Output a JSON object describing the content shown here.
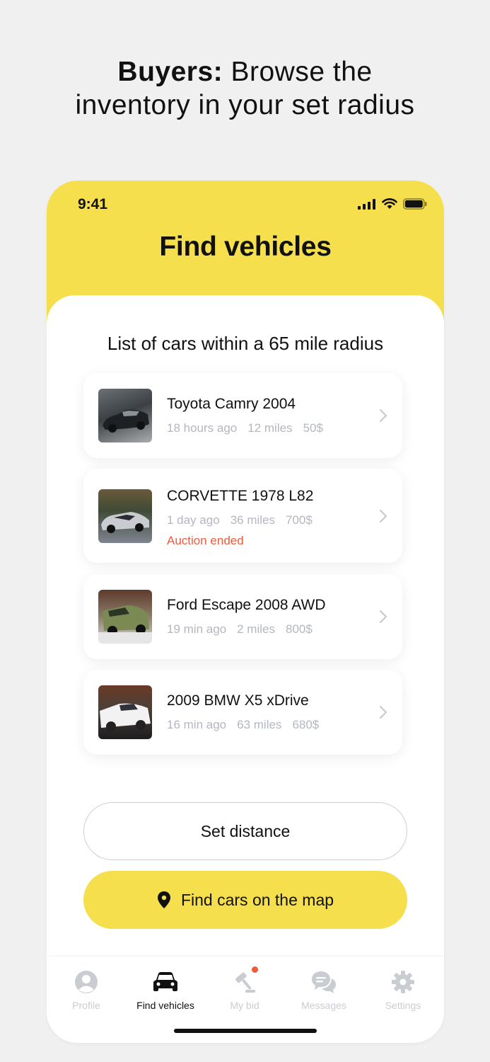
{
  "headline": {
    "bold": "Buyers:",
    "rest": " Browse the",
    "line2": "inventory in your set radius"
  },
  "status_bar": {
    "time": "9:41"
  },
  "screen": {
    "title": "Find vehicles",
    "list_title": "List of cars within a 65 mile radius"
  },
  "cars": [
    {
      "name": "Toyota Camry 2004",
      "time": "18 hours ago",
      "distance": "12 miles",
      "price": "50$",
      "status": ""
    },
    {
      "name": "CORVETTE 1978 L82",
      "time": "1 day ago",
      "distance": "36 miles",
      "price": "700$",
      "status": "Auction ended"
    },
    {
      "name": "Ford Escape 2008 AWD",
      "time": "19 min ago",
      "distance": "2 miles",
      "price": "800$",
      "status": ""
    },
    {
      "name": "2009 BMW X5 xDrive",
      "time": "16 min ago",
      "distance": "63 miles",
      "price": "680$",
      "status": ""
    }
  ],
  "buttons": {
    "set_distance": "Set distance",
    "find_on_map": "Find cars on the map"
  },
  "tabs": [
    {
      "label": "Profile",
      "icon": "profile-icon"
    },
    {
      "label": "Find vehicles",
      "icon": "car-icon"
    },
    {
      "label": "My bid",
      "icon": "gavel-icon"
    },
    {
      "label": "Messages",
      "icon": "chat-icon"
    },
    {
      "label": "Settings",
      "icon": "gear-icon"
    }
  ],
  "colors": {
    "accent": "#f5df4d",
    "alert": "#f05a3c",
    "muted": "#b3b7bf",
    "background": "#f0f0f0"
  }
}
